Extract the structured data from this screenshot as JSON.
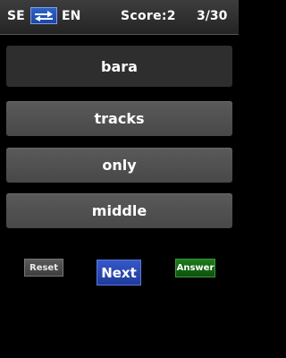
{
  "header": {
    "lang_from": "SE",
    "lang_to": "EN",
    "score": "Score:2",
    "progress": "3/30"
  },
  "quiz": {
    "word": "bara",
    "options": [
      "tracks",
      "only",
      "middle"
    ]
  },
  "buttons": {
    "reset": "Reset",
    "next": "Next",
    "answer": "Answer"
  },
  "colors": {
    "swap_button": "#1c46a3",
    "next_button": "#1f3a9c",
    "answer_button": "#0d520d"
  }
}
